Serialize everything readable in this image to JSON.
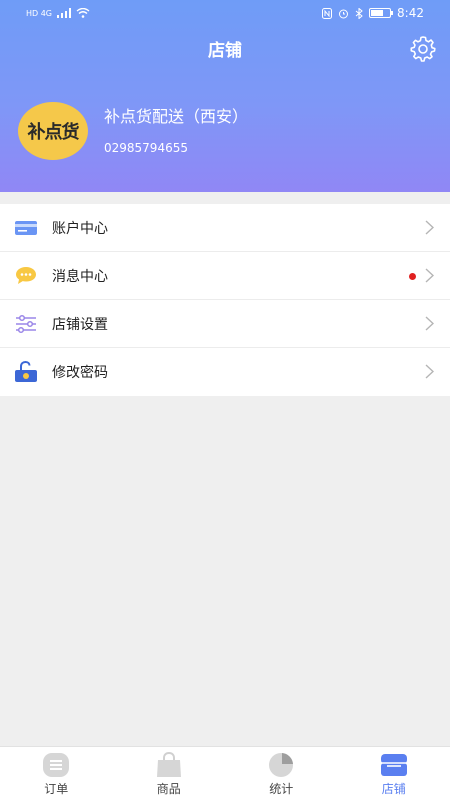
{
  "statusbar": {
    "time": "8:42",
    "network": "HD 4G"
  },
  "header": {
    "title": "店铺"
  },
  "store": {
    "logo_text": "补点货",
    "name": "补点货配送（西安）",
    "phone": "02985794655"
  },
  "menu": [
    {
      "label": "账户中心",
      "icon": "card-icon",
      "has_dot": false
    },
    {
      "label": "消息中心",
      "icon": "chat-bubble-icon",
      "has_dot": true
    },
    {
      "label": "店铺设置",
      "icon": "sliders-icon",
      "has_dot": false
    },
    {
      "label": "修改密码",
      "icon": "unlock-icon",
      "has_dot": false
    }
  ],
  "tabs": [
    {
      "label": "订单",
      "icon": "order-icon",
      "active": false
    },
    {
      "label": "商品",
      "icon": "bag-icon",
      "active": false
    },
    {
      "label": "统计",
      "icon": "pie-icon",
      "active": false
    },
    {
      "label": "店铺",
      "icon": "store-icon",
      "active": true
    }
  ],
  "colors": {
    "accent": "#5a7ff0",
    "header_top": "#6f9cf7",
    "header_bottom": "#9087f5",
    "dot": "#e02020"
  }
}
